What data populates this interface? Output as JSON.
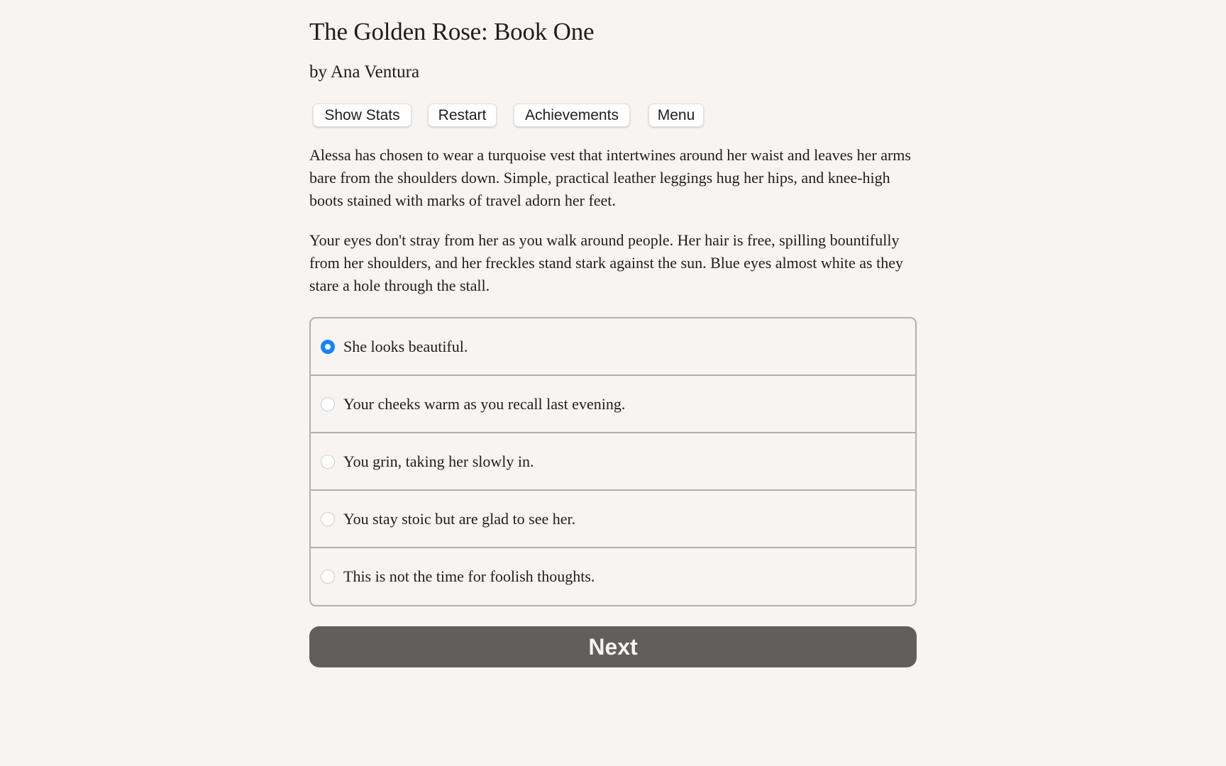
{
  "header": {
    "title": "The Golden Rose: Book One",
    "byline": "by Ana Ventura"
  },
  "toolbar": {
    "show_stats_label": "Show Stats",
    "restart_label": "Restart",
    "achievements_label": "Achievements",
    "menu_label": "Menu"
  },
  "story": {
    "paragraphs": [
      "Alessa has chosen to wear a turquoise vest that intertwines around her waist and leaves her arms bare from the shoulders down. Simple, practical leather leggings hug her hips, and knee-high boots stained with marks of travel adorn her feet.",
      "Your eyes don't stray from her as you walk around people. Her hair is free, spilling bountifully from her shoulders, and her freckles stand stark against the sun. Blue eyes almost white as they stare a hole through the stall."
    ]
  },
  "choices": {
    "selected_index": 0,
    "options": [
      {
        "label": "She looks beautiful.",
        "selected": true
      },
      {
        "label": "Your cheeks warm as you recall last evening.",
        "selected": false
      },
      {
        "label": "You grin, taking her slowly in.",
        "selected": false
      },
      {
        "label": "You stay stoic but are glad to see her.",
        "selected": false
      },
      {
        "label": "This is not the time for foolish thoughts.",
        "selected": false
      }
    ]
  },
  "next_button": {
    "label": "Next"
  },
  "colors": {
    "background": "#f7f4f1",
    "accent_radio": "#1a82f5",
    "next_button": "#605f5d",
    "border": "#b2b0ae"
  }
}
